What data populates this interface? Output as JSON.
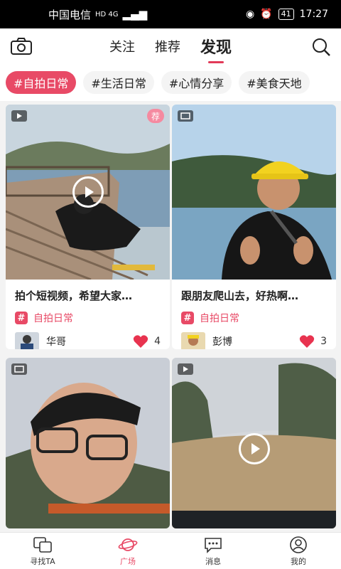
{
  "status": {
    "carrier": "中国电信",
    "network": "HD 4G",
    "battery": "41",
    "time": "17:27"
  },
  "topnav": {
    "tabs": [
      "关注",
      "推荐",
      "发现"
    ],
    "active": 2
  },
  "tags": [
    "#自拍日常",
    "#生活日常",
    "#心情分享",
    "#美食天地"
  ],
  "cards": [
    {
      "title": "拍个短视频，希望大家…",
      "tag": "自拍日常",
      "user": "华哥",
      "likes": "4",
      "type": "video",
      "recommended": "荐"
    },
    {
      "title": "跟朋友爬山去，好热啊…",
      "tag": "自拍日常",
      "user": "彭博",
      "likes": "3",
      "type": "photo"
    },
    {
      "type": "photo"
    },
    {
      "type": "video"
    }
  ],
  "bottom_nav": [
    "寻找TA",
    "广场",
    "消息",
    "我的"
  ],
  "colors": {
    "accent": "#e84a66",
    "heart": "#e8334f"
  }
}
